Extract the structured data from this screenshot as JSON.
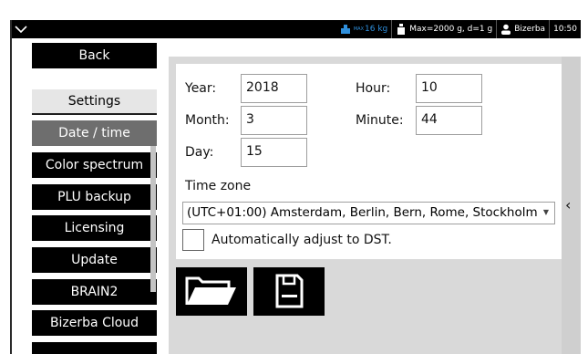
{
  "topbar": {
    "max_load": "16 kg",
    "max_badge": "MAX",
    "range": "Max=2000 g, d=1 g",
    "user": "Bizerba",
    "time": "10:50"
  },
  "sidebar": {
    "items": [
      {
        "label": "Back"
      },
      {
        "label": "Settings"
      },
      {
        "label": "Date / time"
      },
      {
        "label": "Color spectrum"
      },
      {
        "label": "PLU backup"
      },
      {
        "label": "Licensing"
      },
      {
        "label": "Update"
      },
      {
        "label": "BRAIN2"
      },
      {
        "label": "Bizerba Cloud"
      }
    ]
  },
  "form": {
    "year_label": "Year:",
    "year_value": "2018",
    "month_label": "Month:",
    "month_value": "3",
    "day_label": "Day:",
    "day_value": "15",
    "hour_label": "Hour:",
    "hour_value": "10",
    "minute_label": "Minute:",
    "minute_value": "44",
    "timezone_label": "Time zone",
    "timezone_value": "(UTC+01:00) Amsterdam, Berlin, Bern, Rome, Stockholm",
    "dst_label": "Automatically adjust to DST."
  },
  "icons": {
    "open": "folder-open-icon",
    "save": "save-disk-icon",
    "collapse": "chevron-left-icon"
  }
}
